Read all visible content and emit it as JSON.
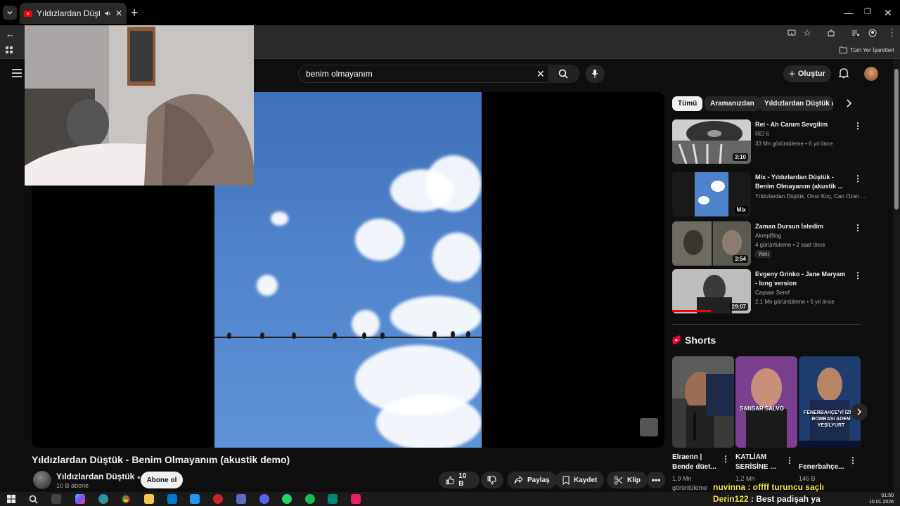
{
  "browser": {
    "tab_title": "Yıldızlardan Düştük - Benim",
    "bookmark_all": "Tüm Yer İşaretleri"
  },
  "header": {
    "search_value": "benim olmayanım",
    "create_label": "Oluştur"
  },
  "video": {
    "title": "Yıldızlardan Düştük - Benim Olmayanım (akustik demo)",
    "channel": "Yıldızlardan Düştük",
    "subscribers": "10 B abone",
    "subscribe_label": "Abone ol",
    "likes": "10 B",
    "share_label": "Paylaş",
    "save_label": "Kaydet",
    "clip_label": "Klip"
  },
  "chips": [
    "Tümü",
    "Aramanızdan",
    "Yıldızlardan Düştük adlı"
  ],
  "recommendations": [
    {
      "title": "Rei - Ah Canım Sevgilim",
      "channel": "REİ 6",
      "meta": "33 Mn görüntüleme • 6 yıl önce",
      "duration": "3:10"
    },
    {
      "title": "Mix - Yıldızlardan Düştük - Benim Olmayanım (akustik ...",
      "channel": "Yıldızlardan Düştük, Onur Koç, Can Ozan ...",
      "meta": "",
      "duration": "Mix"
    },
    {
      "title": "Zaman Dursun İstedim",
      "channel": "AkrepBlog",
      "meta": "4 görüntüleme • 2 saat önce",
      "badge": "Yeni",
      "duration": "3:54"
    },
    {
      "title": "Evgeny Grinko - Jane Maryam - long version",
      "channel": "Captain Seref",
      "meta": "2,1 Mn görüntüleme • 5 yıl önce",
      "duration": "29:07"
    }
  ],
  "shorts": {
    "heading": "Shorts",
    "items": [
      {
        "caption": "Elraenn | Bende düet...",
        "views": "1,9 Mn",
        "extra": "görüntüleme",
        "overlay": ""
      },
      {
        "caption": "KATLİAM SERİSİNE ...",
        "views": "1,2 Mn",
        "extra": "",
        "overlay": "SANSAR SALVO"
      },
      {
        "caption": "Fenerbahçe...",
        "views": "146 B",
        "extra": "",
        "overlay": "FENERBAHÇE'Yİ İZMİR BOMBASI ADEM YEŞİLYURT"
      }
    ]
  },
  "stream_overlay": {
    "line1": "nuvinna : offff turuncu saçlı",
    "user": "Derin122",
    "line2": " : Best padişah ya"
  },
  "clock": {
    "time": "01:50",
    "date": "10.01.2026"
  }
}
